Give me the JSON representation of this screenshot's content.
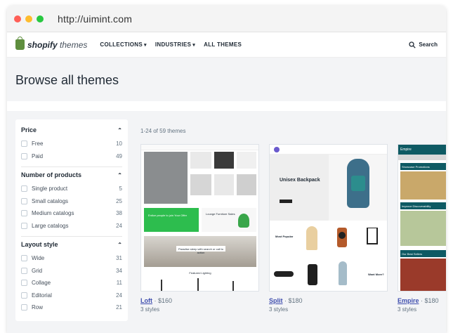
{
  "browser": {
    "url": "http://uimint.com"
  },
  "nav": {
    "logo_bold": "shopify",
    "logo_light": "themes",
    "links": [
      "COLLECTIONS",
      "INDUSTRIES",
      "ALL THEMES"
    ],
    "search_label": "Search"
  },
  "hero": {
    "title": "Browse all themes"
  },
  "filters": [
    {
      "title": "Price",
      "items": [
        {
          "label": "Free",
          "count": "10"
        },
        {
          "label": "Paid",
          "count": "49"
        }
      ]
    },
    {
      "title": "Number of products",
      "items": [
        {
          "label": "Single product",
          "count": "5"
        },
        {
          "label": "Small catalogs",
          "count": "25"
        },
        {
          "label": "Medium catalogs",
          "count": "38"
        },
        {
          "label": "Large catalogs",
          "count": "24"
        }
      ]
    },
    {
      "title": "Layout style",
      "items": [
        {
          "label": "Wide",
          "count": "31"
        },
        {
          "label": "Grid",
          "count": "34"
        },
        {
          "label": "Collage",
          "count": "11"
        },
        {
          "label": "Editorial",
          "count": "24"
        },
        {
          "label": "Row",
          "count": "21"
        }
      ]
    }
  ],
  "results": {
    "count_text": "1-24 of 59 themes"
  },
  "themes": [
    {
      "name": "Loft",
      "price": "$160",
      "styles": "3 styles",
      "preview": {
        "banner": "Entice people to join Your Offer",
        "banner2": "Lounge Furniture Sales",
        "banner3": "Paradise sleep with search or call to action",
        "tag": "Featured Lighting"
      }
    },
    {
      "name": "Split",
      "price": "$180",
      "styles": "3 styles",
      "preview": {
        "headline": "Unisex Backpack",
        "label1": "Most Popular",
        "label2": "Want More?"
      }
    },
    {
      "name": "Empire",
      "price": "$180",
      "styles": "3 styles",
      "preview": {
        "brand": "Empire",
        "p1": "Showcase Promotions",
        "p2": "Improve Discoverability",
        "p3": "Our Best Sellers"
      }
    }
  ],
  "colors": {
    "brand_green": "#5e8e3e",
    "link": "#3f4eae",
    "promo_green": "#2dbd4e",
    "empire_teal": "#0e5a63"
  }
}
